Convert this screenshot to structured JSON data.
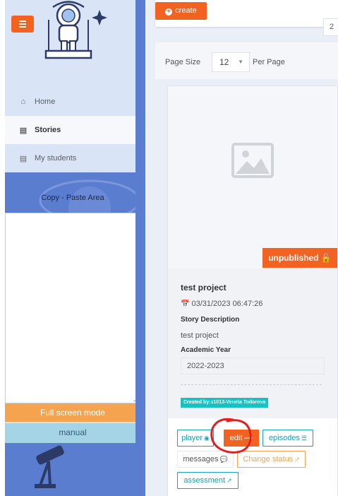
{
  "sidebar": {
    "nav": [
      {
        "label": "Home",
        "icon": "home-icon",
        "active": false
      },
      {
        "label": "Stories",
        "icon": "list-icon",
        "active": true
      },
      {
        "label": "My students",
        "icon": "list-icon",
        "active": false
      }
    ],
    "paste_area_label": "Copy - Paste Area",
    "fullscreen_label": "Full screen mode",
    "manual_label": "manual"
  },
  "toolbar": {
    "create_label": "create",
    "page_number": "2"
  },
  "pagination": {
    "page_size_label": "Page Size",
    "page_size_value": "12",
    "per_page_label": "Per Page"
  },
  "card": {
    "status": "unpublished",
    "title": "test project",
    "date": "03/31/2023 06:47:26",
    "description_label": "Story Description",
    "description_value": "test project",
    "year_label": "Academic Year",
    "year_value": "2022-2023",
    "created_by": "Created by:s1013-Veneta Todorova",
    "buttons": {
      "player": "player",
      "edit": "edit",
      "episodes": "episodes",
      "messages": "messages",
      "change_status": "Change status",
      "assessment": "assessment"
    }
  },
  "colors": {
    "accent": "#f26322",
    "teal": "#17a2b8",
    "orange_light": "#f5a34e",
    "sidebar_blue": "#5b7dd0",
    "annotation_red": "#e02020"
  }
}
